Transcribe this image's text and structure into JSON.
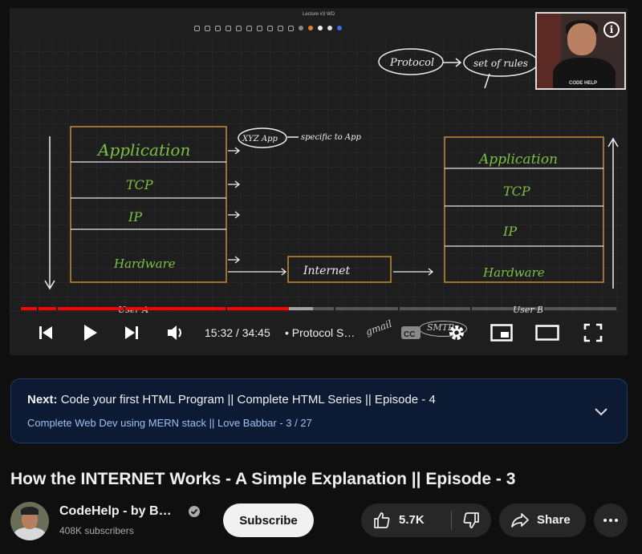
{
  "player": {
    "lecture_title": "Lecture #3 WD",
    "board_notes": {
      "protocol": "Protocol",
      "set_of_rules": "set of rules",
      "xyz_app": "XYZ App",
      "specific_to_app": "specific to App",
      "left_stack": [
        "Application",
        "TCP",
        "IP",
        "Hardware"
      ],
      "internet": "Internet",
      "right_stack": [
        "Application",
        "TCP",
        "IP",
        "Hardware"
      ],
      "user_a": "User A",
      "user_b": "User B",
      "gmail": "gmail",
      "smtp": "SMTP"
    },
    "webcam_brand": "CODE HELP",
    "progress": {
      "played_fraction": 0.45,
      "buffered_fraction": 0.49
    },
    "time_current": "15:32",
    "time_total": "34:45",
    "time_display": "15:32 / 34:45",
    "chapter": "Protocol S…",
    "icons": {
      "prev": "skip-previous-icon",
      "play": "play-icon",
      "next": "skip-next-icon",
      "volume": "volume-icon",
      "cc": "closed-captions-icon",
      "settings": "gear-icon",
      "miniplayer": "miniplayer-icon",
      "theater": "theater-mode-icon",
      "fullscreen": "fullscreen-icon"
    }
  },
  "up_next": {
    "label": "Next:",
    "video_title": "Code your first HTML Program || Complete HTML Series || Episode - 4",
    "playlist_info": "Complete Web Dev using MERN stack || Love Babbar - 3 / 27"
  },
  "video": {
    "title": "How the INTERNET Works - A Simple Explanation || Episode - 3",
    "channel_name": "CodeHelp - by B…",
    "subscribers": "408K subscribers",
    "subscribe_label": "Subscribe",
    "like_count": "5.7K",
    "share_label": "Share"
  },
  "colors": {
    "background": "#0f0f0f",
    "progress_red": "#ff0000",
    "pill": "#272727",
    "next_panel": "#0c1a33",
    "chalk_green": "#7bc043",
    "box_orange": "#c98a3a"
  }
}
